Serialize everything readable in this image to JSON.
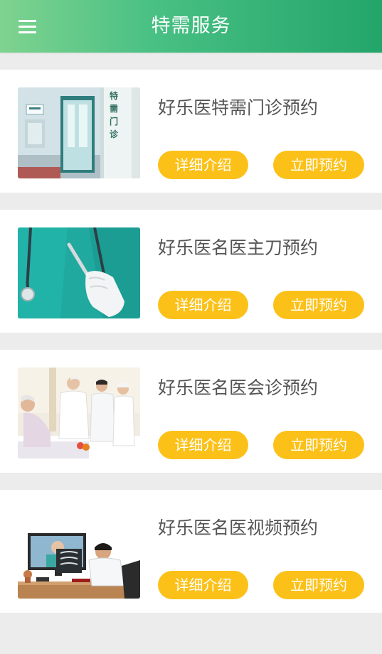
{
  "header": {
    "title": "特需服务",
    "background": "#3dba7e"
  },
  "colors": {
    "button": "#fcc118",
    "button_text": "#ffffff",
    "card_title": "#555555",
    "page_bg": "#ececec"
  },
  "icons": {
    "menu": "hamburger-menu-icon"
  },
  "services": [
    {
      "title": "好乐医特需门诊预约",
      "image": "special-clinic-door-photo",
      "sign_text": "特需门诊",
      "detail_label": "详细介绍",
      "book_label": "立即预约"
    },
    {
      "title": "好乐医名医主刀预约",
      "image": "surgeon-with-scalpel-photo",
      "detail_label": "详细介绍",
      "book_label": "立即预约"
    },
    {
      "title": "好乐医名医会诊预约",
      "image": "doctors-visiting-patient-photo",
      "detail_label": "详细介绍",
      "book_label": "立即预约"
    },
    {
      "title": "好乐医名医视频预约",
      "image": "video-consultation-xray-photo",
      "detail_label": "详细介绍",
      "book_label": "立即预约"
    }
  ]
}
